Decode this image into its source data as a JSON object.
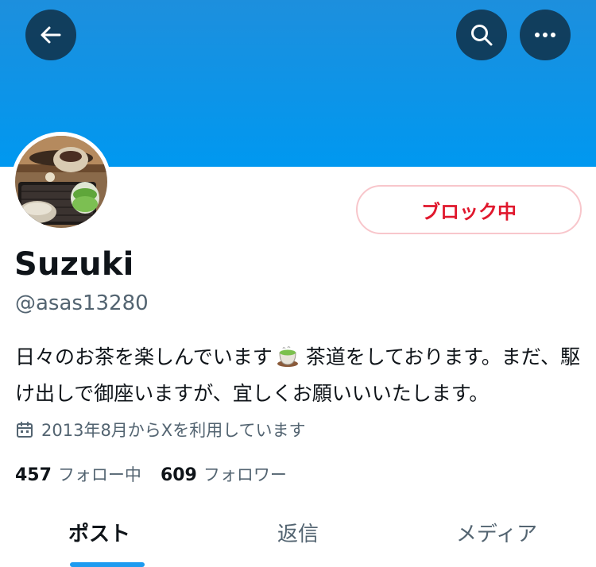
{
  "header": {
    "back_icon": "arrow-left-icon",
    "search_icon": "search-icon",
    "more_icon": "more-horizontal-icon",
    "banner_color": "#0098f0"
  },
  "profile": {
    "display_name": "Suzuki",
    "handle": "@asas13280",
    "block_label": "ブロック中",
    "bio_part1": "日々のお茶を楽しんでいます",
    "bio_emoji": "tea-cup-emoji",
    "bio_part2": "茶道をしております。まだ、駆け出しで御座いますが、宜しくお願いいいたします。",
    "joined_icon": "calendar-icon",
    "joined": "2013年8月からXを利用しています",
    "following_count": "457",
    "following_label": "フォロー中",
    "followers_count": "609",
    "followers_label": "フォロワー"
  },
  "tabs": [
    {
      "label": "ポスト",
      "active": true
    },
    {
      "label": "返信",
      "active": false
    },
    {
      "label": "メディア",
      "active": false
    }
  ],
  "colors": {
    "accent": "#1d9bf0",
    "block_red": "#e0182d",
    "secondary_text": "#536471"
  }
}
